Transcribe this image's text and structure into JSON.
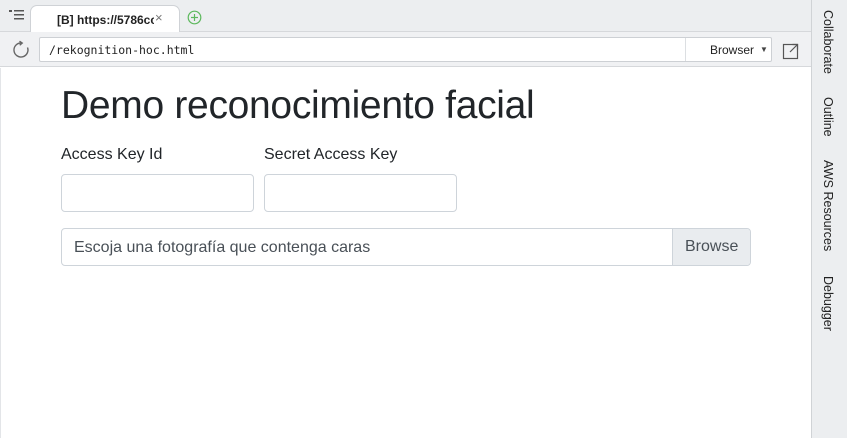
{
  "tabs": [
    {
      "title": "[B] https://5786cc",
      "close_glyph": "×"
    }
  ],
  "address_bar": {
    "url": "/rekognition-hoc.html",
    "browser_select": "Browser"
  },
  "side_panel": {
    "tabs": [
      "Collaborate",
      "Outline",
      "AWS Resources",
      "Debugger"
    ]
  },
  "page": {
    "title": "Demo reconocimiento facial",
    "access_key_label": "Access Key Id",
    "secret_key_label": "Secret Access Key",
    "access_key_value": "",
    "secret_key_value": "",
    "file_placeholder": "Escoja una fotografía que contenga caras",
    "browse_label": "Browse"
  },
  "icons": {
    "tab_menu": "list-menu-icon",
    "new_tab": "plus-circle-icon",
    "reload": "reload-icon",
    "popout": "popout-window-icon"
  },
  "colors": {
    "chrome_bg": "#eceef0",
    "new_tab_green": "#5cb85c",
    "text": "#212529",
    "input_border": "#ced4da",
    "browse_bg": "#e9ecef"
  }
}
